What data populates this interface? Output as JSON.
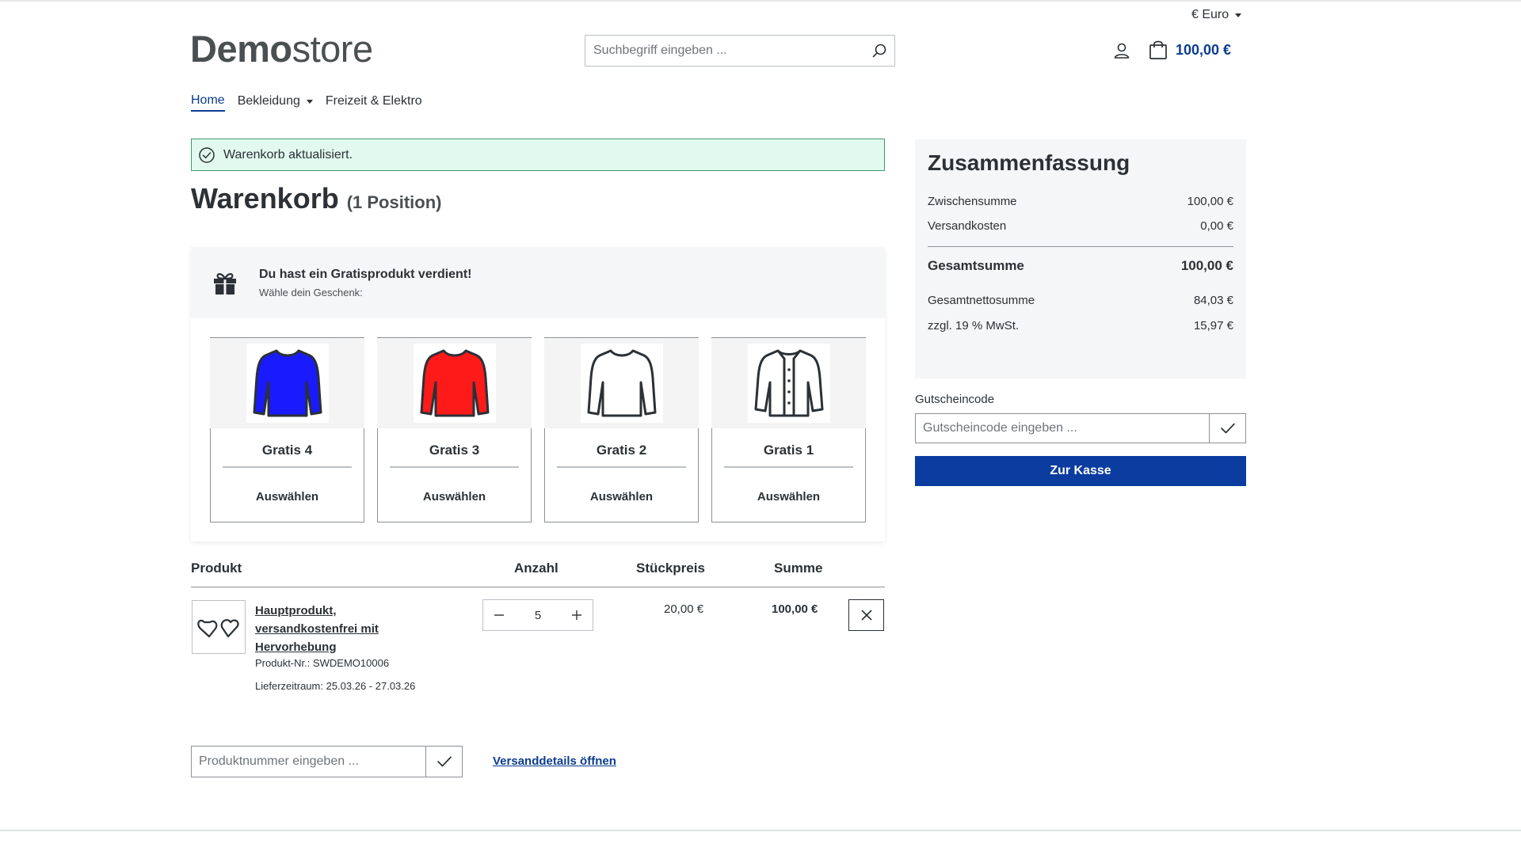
{
  "header": {
    "currency_label": "€ Euro",
    "logo_bold": "Demo",
    "logo_rest": "store",
    "search_placeholder": "Suchbegriff eingeben ...",
    "cart_total": "100,00 €"
  },
  "nav": {
    "items": [
      {
        "label": "Home",
        "active": true
      },
      {
        "label": "Bekleidung",
        "has_dropdown": true
      },
      {
        "label": "Freizeit & Elektro"
      }
    ]
  },
  "alert": {
    "message": "Warenkorb aktualisiert."
  },
  "page": {
    "title": "Warenkorb",
    "count": "(1 Position)"
  },
  "gift": {
    "title": "Du hast ein Gratisprodukt verdient!",
    "subtitle": "Wähle dein Geschenk:",
    "select_label": "Auswählen",
    "cards": [
      {
        "name": "Gratis 4",
        "icon": "shirt-icon",
        "color": "#1a1aff"
      },
      {
        "name": "Gratis 3",
        "icon": "shirt-icon",
        "color": "#ff1a1a"
      },
      {
        "name": "Gratis 2",
        "icon": "shirt-icon",
        "color": "#ffffff"
      },
      {
        "name": "Gratis 1",
        "icon": "jacket-icon",
        "color": "#ffffff"
      }
    ]
  },
  "table": {
    "headers": {
      "product": "Produkt",
      "quantity": "Anzahl",
      "unit_price": "Stückpreis",
      "total": "Summe"
    },
    "row": {
      "name_line1": "Hauptprodukt,",
      "name_line2": "versandkostenfrei mit",
      "name_line3": "Hervorhebung",
      "product_number": "Produkt-Nr.: SWDEMO10006",
      "delivery": "Lieferzeitraum: 25.03.26 - 27.03.26",
      "quantity": "5",
      "unit_price": "20,00 €",
      "total": "100,00 €"
    }
  },
  "product_number_input": {
    "placeholder": "Produktnummer eingeben ..."
  },
  "shipping_link": "Versanddetails öffnen",
  "summary": {
    "title": "Zusammenfassung",
    "subtotal_label": "Zwischensumme",
    "subtotal": "100,00 €",
    "shipping_label": "Versandkosten",
    "shipping": "0,00 €",
    "grand_total_label": "Gesamtsumme",
    "grand_total": "100,00 €",
    "net_label": "Gesamtnettosumme",
    "net": "84,03 €",
    "vat_label": "zzgl. 19 % MwSt.",
    "vat": "15,97 €"
  },
  "voucher": {
    "label": "Gutscheincode",
    "placeholder": "Gutscheincode eingeben ..."
  },
  "checkout_label": "Zur Kasse",
  "colors": {
    "accent": "#0b3c8f",
    "success_bg": "#e1f9ee",
    "success_border": "#3c9b6e",
    "checkout_bg": "#0b3c9f"
  }
}
